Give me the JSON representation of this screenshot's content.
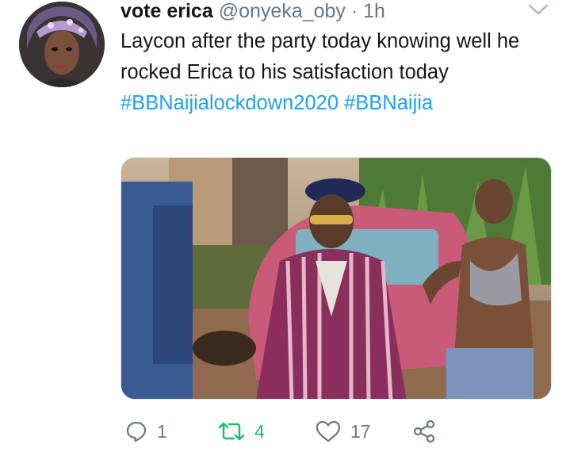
{
  "tweet": {
    "display_name": "vote erica",
    "handle": "@onyeka_oby",
    "separator": "·",
    "time": "1h",
    "text_plain": "Laycon after the party today knowing well he rocked Erica to his satisfaction today",
    "hashtags": [
      "#BBNaijialockdown2020",
      "#BBNaijia"
    ]
  },
  "actions": {
    "reply_count": "1",
    "retweet_count": "4",
    "like_count": "17"
  },
  "colors": {
    "accent": "#1da1f2",
    "retweet": "#17bf63",
    "secondary_text": "#657786"
  },
  "icons": [
    "reply-icon",
    "retweet-icon",
    "like-icon",
    "share-icon",
    "chevron-down-icon"
  ]
}
